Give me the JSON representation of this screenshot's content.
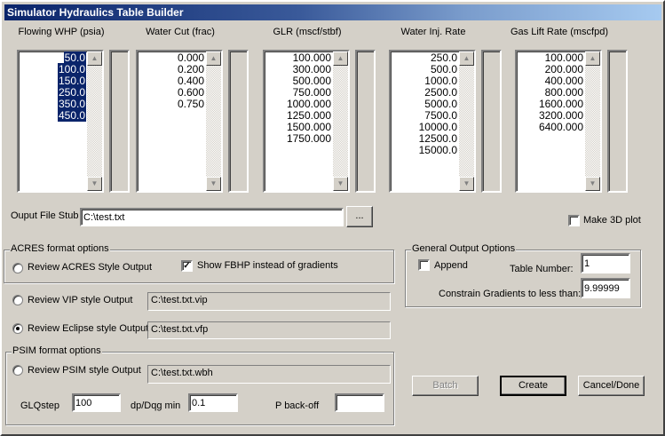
{
  "window": {
    "title": "Simulator Hydraulics Table Builder"
  },
  "lists": [
    {
      "header": "Flowing WHP (psia)",
      "items": [
        "50.0",
        "100.0",
        "150.0",
        "250.0",
        "350.0",
        "450.0"
      ],
      "selected": true
    },
    {
      "header": "Water Cut (frac)",
      "items": [
        "0.000",
        "0.200",
        "0.400",
        "0.600",
        "0.750"
      ],
      "selected": false
    },
    {
      "header": "GLR (mscf/stbf)",
      "items": [
        "100.000",
        "300.000",
        "500.000",
        "750.000",
        "1000.000",
        "1250.000",
        "1500.000",
        "1750.000"
      ],
      "selected": false
    },
    {
      "header": "Water Inj. Rate",
      "items": [
        "250.0",
        "500.0",
        "1000.0",
        "2500.0",
        "5000.0",
        "7500.0",
        "10000.0",
        "12500.0",
        "15000.0"
      ],
      "selected": false
    },
    {
      "header": "Gas Lift Rate (mscfpd)",
      "items": [
        "100.000",
        "200.000",
        "400.000",
        "800.000",
        "1600.000",
        "3200.000",
        "6400.000"
      ],
      "selected": false
    }
  ],
  "output": {
    "label": "Ouput File Stub",
    "value": "C:\\test.txt",
    "browse": "..."
  },
  "make3d": {
    "label": "Make 3D plot",
    "checked": false
  },
  "acres": {
    "group": "ACRES format options",
    "radio": "Review ACRES Style Output",
    "show_fbhp": "Show FBHP instead of gradients",
    "show_fbhp_checked": true
  },
  "vip": {
    "radio": "Review VIP style Output",
    "file": "C:\\test.txt.vip"
  },
  "eclipse": {
    "radio": "Review Eclipse style Output",
    "file": "C:\\test.txt.vfp",
    "selected": true
  },
  "psim": {
    "group": "PSIM format options",
    "radio": "Review PSIM style Output",
    "file": "C:\\test.txt.wbh",
    "glqstep_label": "GLQstep",
    "glqstep": "100",
    "dpdqg_label": "dp/Dqg min",
    "dpdqg": "0.1",
    "pbackoff_label": "P back-off",
    "pbackoff": ""
  },
  "general": {
    "group": "General Output Options",
    "append": "Append",
    "append_checked": false,
    "table_label": "Table Number:",
    "table": "1",
    "constrain_label": "Constrain Gradients to less than:",
    "constrain": "9.99999"
  },
  "buttons": {
    "batch": "Batch",
    "create": "Create",
    "cancel": "Cancel/Done"
  }
}
